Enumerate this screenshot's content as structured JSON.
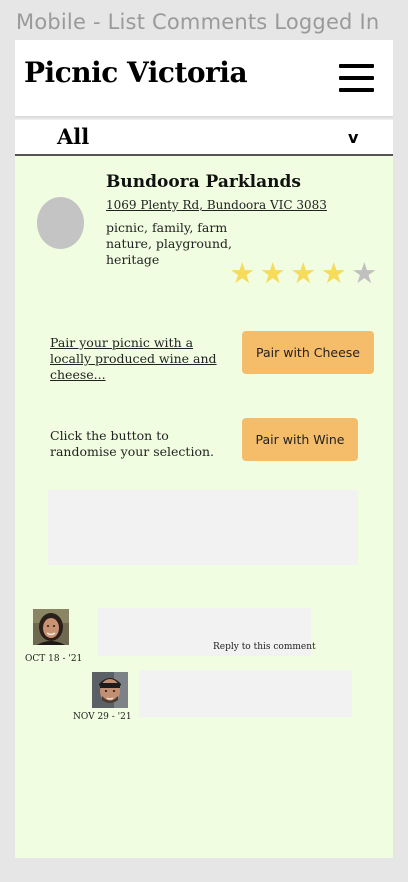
{
  "frame": {
    "title": "Mobile - List Comments Logged In"
  },
  "header": {
    "title": "Picnic Victoria",
    "menu_icon": "hamburger-menu-icon"
  },
  "filter": {
    "selected": "All",
    "chevron": "v"
  },
  "place": {
    "name": "Bundoora Parklands",
    "address": "1069 Plenty Rd, Bundoora VIC 3083",
    "tags": "picnic, family, farm nature, playground, heritage",
    "rating": 4,
    "rating_max": 5,
    "star_on_color": "#f6dc5a",
    "star_off_color": "#c0c0c0"
  },
  "pairing": {
    "prompt": "Pair your picnic with a locally produced wine and cheese...",
    "cheese_button": "Pair with Cheese",
    "randomise_text": "Click the button to randomise your selection.",
    "wine_button": "Pair with Wine",
    "button_color": "#f5bc6a"
  },
  "comments": [
    {
      "date": "OCT 18 - '21",
      "reply_label": "Reply to this comment",
      "avatar": "woman-avatar"
    },
    {
      "date": "NOV 29 - '21",
      "avatar": "man-avatar"
    }
  ]
}
